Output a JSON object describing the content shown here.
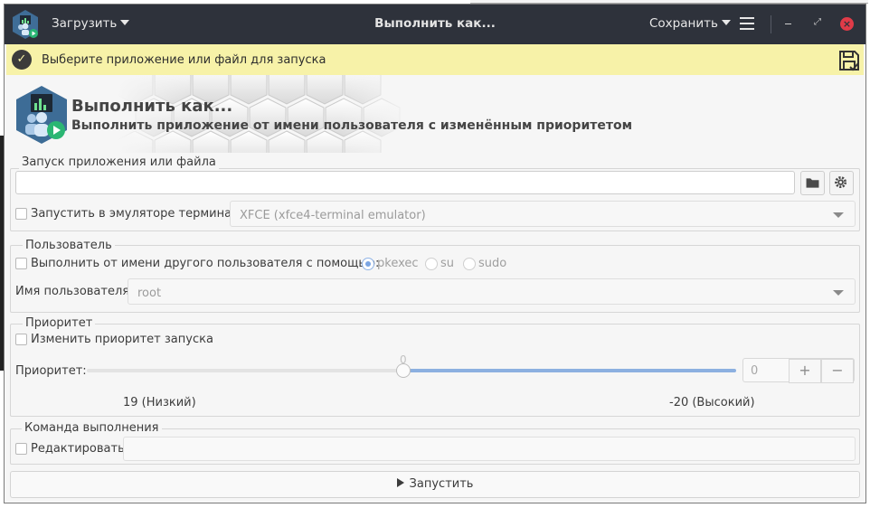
{
  "header": {
    "load_menu": "Загрузить",
    "title": "Выполнить как...",
    "save_menu": "Сохранить"
  },
  "infobar": {
    "message": "Выберите приложение или файл для запуска"
  },
  "banner": {
    "title": "Выполнить как...",
    "subtitle": "Выполнить приложение от имени пользователя с изменённым приоритетом"
  },
  "launch": {
    "frame_label": "Запуск приложения или файла",
    "path_value": "",
    "terminal_checkbox_label": "Запустить в эмуляторе терминала",
    "terminal_checked": false,
    "terminal_selected": "XFCE (xfce4-terminal emulator)"
  },
  "user": {
    "frame_label": "Пользователь",
    "other_user_label": "Выполнить от имени другого пользователя с помощью:",
    "other_user_checked": false,
    "methods": [
      "pkexec",
      "su",
      "sudo"
    ],
    "selected_method": "pkexec",
    "username_label": "Имя пользователя:",
    "username_selected": "root"
  },
  "priority": {
    "frame_label": "Приоритет",
    "change_label": "Изменить приоритет запуска",
    "change_checked": false,
    "priority_label": "Приоритет:",
    "slider_value_label": "0",
    "slider_value": 0,
    "slider_min": 19,
    "slider_max": -20,
    "spin_value": "0",
    "plus": "+",
    "minus": "−",
    "low_label": "19 (Низкий)",
    "high_label": "-20 (Высокий)"
  },
  "command": {
    "frame_label": "Команда выполнения",
    "edit_label": "Редактировать",
    "edit_checked": false,
    "command_value": ""
  },
  "run_button": "Запустить",
  "colors": {
    "header_bg": "#2e323b",
    "infobar_bg": "#f7f2a8",
    "accent": "#7aa5e3",
    "close": "#e03b48"
  },
  "icons": {
    "app": "runas-app-icon",
    "info": "check-circle-icon",
    "save": "save-settings-icon",
    "folder": "folder-icon",
    "settings": "gear-icon",
    "menu": "hamburger-menu-icon",
    "run": "play-icon"
  }
}
